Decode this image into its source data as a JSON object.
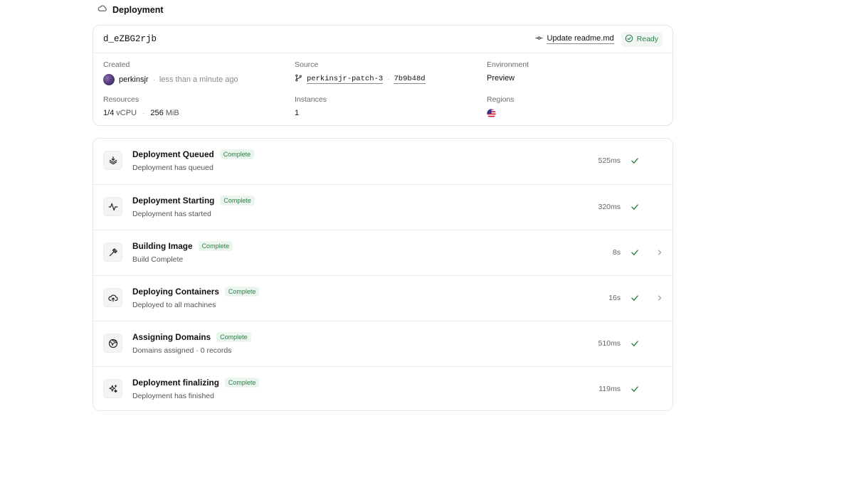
{
  "header": {
    "title": "Deployment",
    "icon": "cloud-icon"
  },
  "summary": {
    "deployment_id": "d_eZBG2rjb",
    "commit_message": "Update readme.md",
    "status": "Ready",
    "status_color": "#2f7d4a",
    "created": {
      "label": "Created",
      "user": "perkinsjr",
      "time": "less than a minute ago"
    },
    "source": {
      "label": "Source",
      "branch": "perkinsjr-patch-3",
      "commit": "7b9b48d"
    },
    "environment": {
      "label": "Environment",
      "value": "Preview"
    },
    "resources": {
      "label": "Resources",
      "cpu_value": "1/4",
      "cpu_unit": "vCPU",
      "mem_value": "256",
      "mem_unit": "MiB"
    },
    "instances": {
      "label": "Instances",
      "value": "1"
    },
    "regions": {
      "label": "Regions",
      "flag": "us-flag-icon"
    }
  },
  "steps": [
    {
      "title": "Deployment Queued",
      "status": "Complete",
      "description": "Deployment has queued",
      "duration": "525ms",
      "icon": "queue-icon",
      "expandable": false
    },
    {
      "title": "Deployment Starting",
      "status": "Complete",
      "description": "Deployment has started",
      "duration": "320ms",
      "icon": "pulse-icon",
      "expandable": false
    },
    {
      "title": "Building Image",
      "status": "Complete",
      "description": "Build Complete",
      "duration": "8s",
      "icon": "hammer-icon",
      "expandable": true
    },
    {
      "title": "Deploying Containers",
      "status": "Complete",
      "description": "Deployed to all machines",
      "duration": "16s",
      "icon": "cloud-upload-icon",
      "expandable": true
    },
    {
      "title": "Assigning Domains",
      "status": "Complete",
      "description": "Domains assigned · 0 records",
      "duration": "510ms",
      "icon": "globe-icon",
      "expandable": false
    },
    {
      "title": "Deployment finalizing",
      "status": "Complete",
      "description": "Deployment has finished",
      "duration": "119ms",
      "icon": "sparkles-icon",
      "expandable": false
    }
  ]
}
